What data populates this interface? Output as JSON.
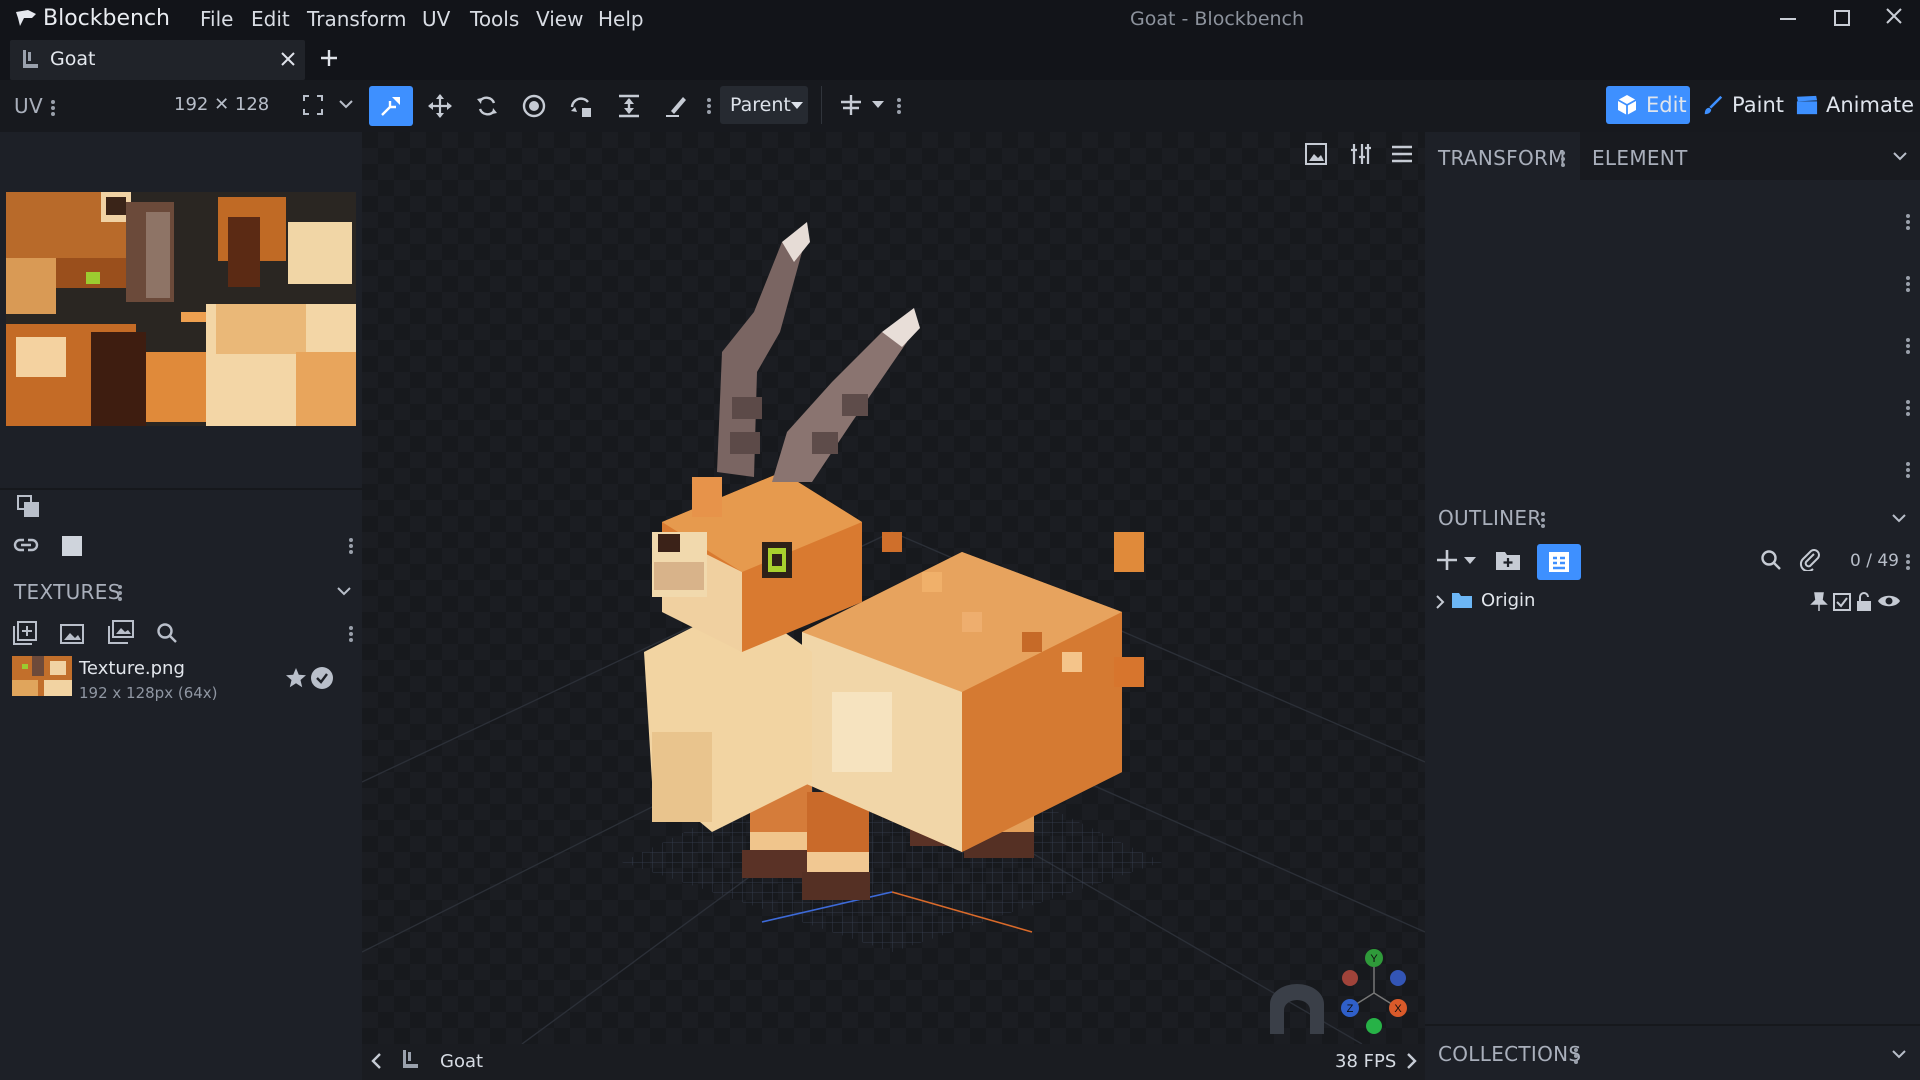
{
  "window": {
    "app_name": "Blockbench",
    "title": "Goat - Blockbench"
  },
  "menu": [
    "File",
    "Edit",
    "Transform",
    "UV",
    "Tools",
    "View",
    "Help"
  ],
  "tab": {
    "label": "Goat"
  },
  "uv_panel": {
    "label": "UV",
    "size": "192 ✕ 128"
  },
  "toolbar": {
    "pivot_select": "Parent"
  },
  "modes": {
    "edit": "Edit",
    "paint": "Paint",
    "animate": "Animate"
  },
  "textures_panel": {
    "label": "TEXTURES",
    "items": [
      {
        "name": "Texture.png",
        "info": "192 x 128px (64x)"
      }
    ]
  },
  "right_panel": {
    "tabs": [
      "TRANSFORM",
      "ELEMENT"
    ],
    "outliner_label": "OUTLINER",
    "outliner_count": "0 / 49",
    "outliner_items": [
      {
        "name": "Origin"
      }
    ],
    "collections_label": "COLLECTIONS"
  },
  "viewport": {
    "model_name": "Goat",
    "fps": "38 FPS"
  },
  "colors": {
    "accent": "#3e90ff",
    "background": "#1b1e24",
    "panel": "#1d2027",
    "titlebar": "#121419"
  },
  "icons": [
    "blockbench-logo-icon",
    "plus-icon",
    "close-icon",
    "move-icon",
    "resize-icon",
    "rotate-icon",
    "pivot-icon",
    "vertex-snap-icon",
    "stretch-icon",
    "brush-icon",
    "search-icon",
    "folder-icon",
    "eye-icon",
    "pin-icon",
    "lock-icon",
    "star-icon",
    "check-icon"
  ]
}
